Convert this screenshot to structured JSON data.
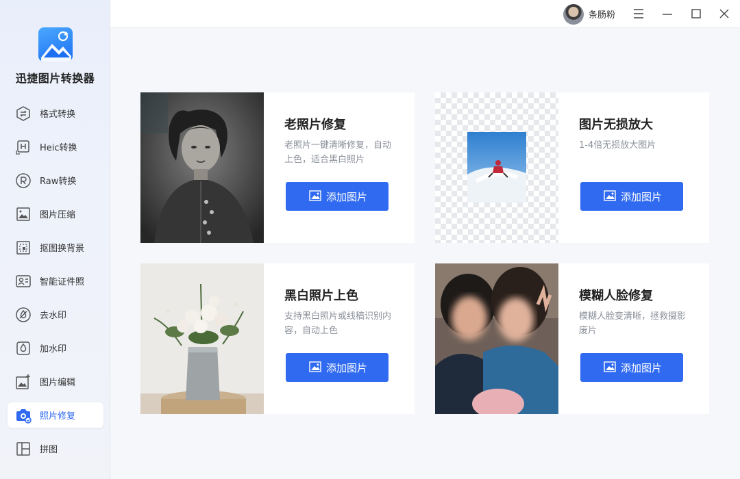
{
  "app": {
    "title": "迅捷图片转换器"
  },
  "sidebar": {
    "items": [
      {
        "label": "格式转换",
        "icon": "format-convert-icon"
      },
      {
        "label": "Heic转换",
        "icon": "heic-icon"
      },
      {
        "label": "Raw转换",
        "icon": "raw-icon"
      },
      {
        "label": "图片压缩",
        "icon": "image-compress-icon"
      },
      {
        "label": "抠图换背景",
        "icon": "cutout-icon"
      },
      {
        "label": "智能证件照",
        "icon": "id-photo-icon"
      },
      {
        "label": "去水印",
        "icon": "remove-watermark-icon"
      },
      {
        "label": "加水印",
        "icon": "add-watermark-icon"
      },
      {
        "label": "图片编辑",
        "icon": "image-edit-icon"
      },
      {
        "label": "照片修复",
        "icon": "photo-repair-icon",
        "active": true
      },
      {
        "label": "拼图",
        "icon": "collage-icon"
      }
    ]
  },
  "titlebar": {
    "username": "条肠粉"
  },
  "cards": [
    {
      "title": "老照片修复",
      "desc": "老照片一键清晰修复，自动上色，适合黑白照片",
      "button": "添加图片"
    },
    {
      "title": "图片无损放大",
      "desc": "1-4倍无损放大图片",
      "button": "添加图片"
    },
    {
      "title": "黑白照片上色",
      "desc": "支持黑白照片或线稿识别内容，自动上色",
      "button": "添加图片"
    },
    {
      "title": "模糊人脸修复",
      "desc": "模糊人脸变清晰，拯救摄影废片",
      "button": "添加图片"
    }
  ],
  "colors": {
    "accent": "#2f6af0",
    "sidebar_bg": "#eef2fb",
    "page_bg": "#f6f7fb"
  }
}
